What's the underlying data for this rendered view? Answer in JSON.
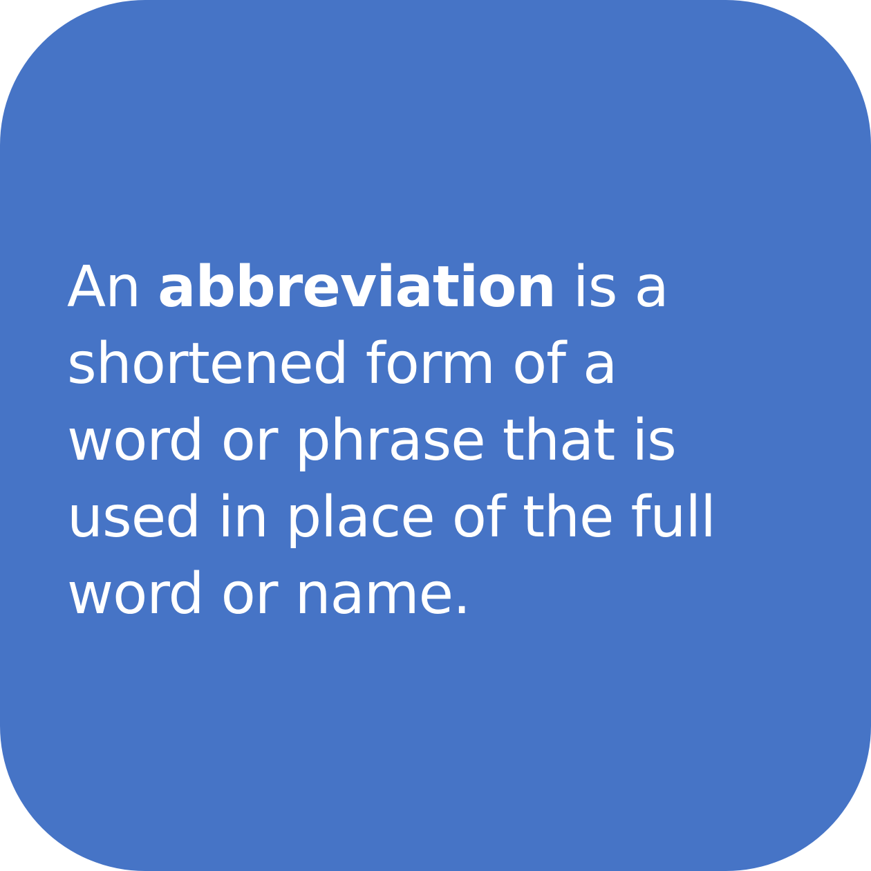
{
  "card": {
    "background_color": "#4674c6",
    "text_color": "#ffffff"
  },
  "definition": {
    "before_term": "An ",
    "term": "abbreviation",
    "after_term": " is a",
    "lines": [
      "shortened form of a",
      "word or phrase that is",
      "used in place of the full",
      "word or name."
    ]
  }
}
